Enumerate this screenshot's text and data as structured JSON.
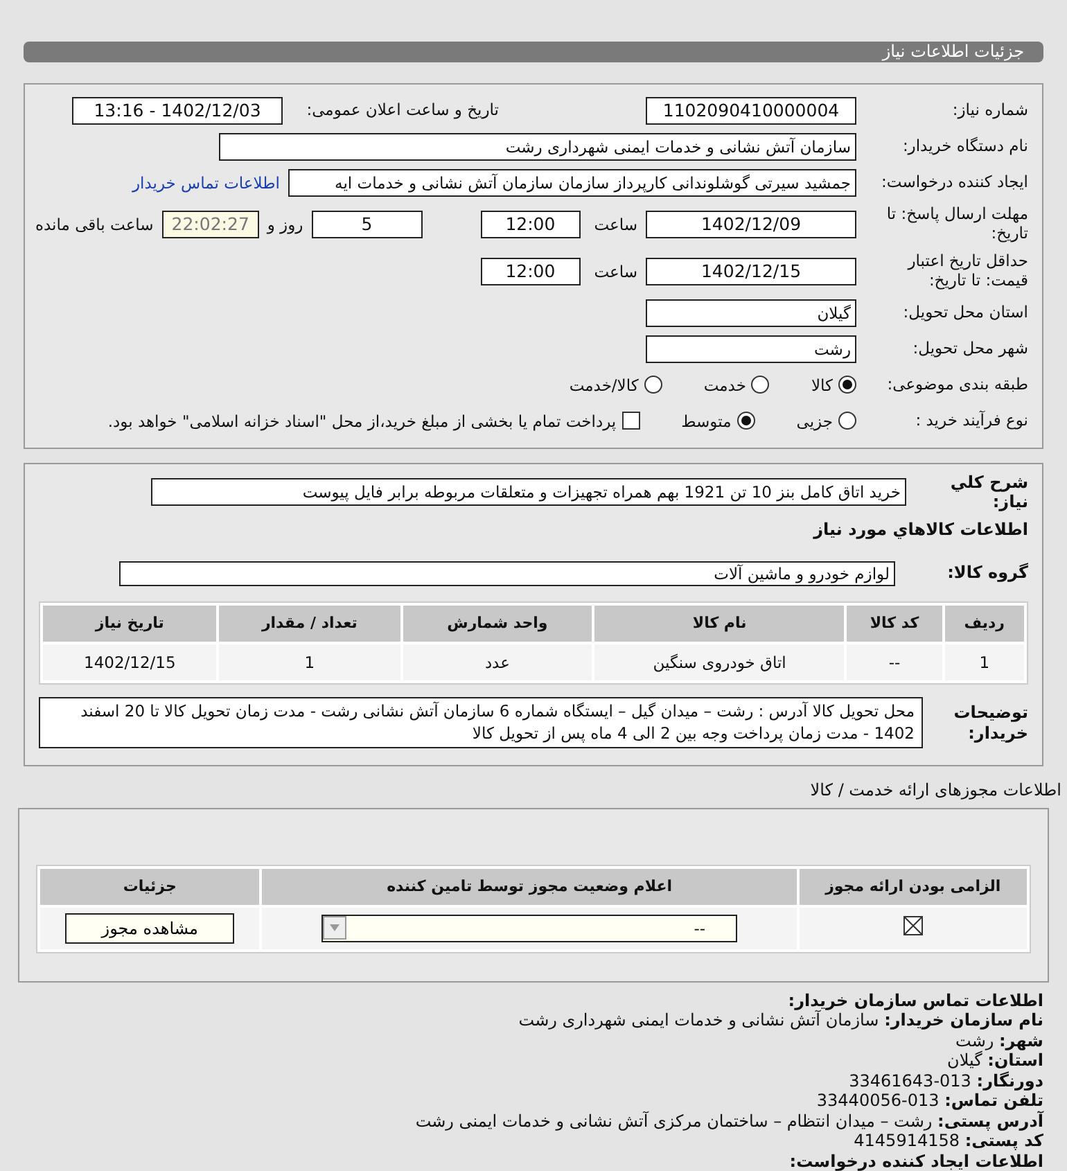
{
  "page_title": "جزئیات اطلاعات نیاز",
  "need": {
    "number_label": "شماره نیاز:",
    "number": "1102090410000004",
    "announce_label": "تاریخ و ساعت اعلان عمومی:",
    "announce": "1402/12/03 - 13:16",
    "buyer_label": "نام دستگاه خریدار:",
    "buyer": "سازمان آتش نشانی و خدمات ایمنی شهرداری رشت",
    "creator_label": "ایجاد کننده درخواست:",
    "creator": "جمشید سیرتی گوشلوندانی کارپرداز سازمان سازمان آتش نشانی و خدمات ایه",
    "contact_link": "اطلاعات تماس خریدار",
    "deadline_label": "مهلت ارسال پاسخ: تا تاریخ:",
    "deadline_date": "1402/12/09",
    "time_label": "ساعت",
    "deadline_time": "12:00",
    "days": "5",
    "days_label": "روز و",
    "remaining": "22:02:27",
    "remaining_label": "ساعت باقی مانده",
    "validity_label": "حداقل تاریخ اعتبار قیمت: تا تاریخ:",
    "validity_date": "1402/12/15",
    "validity_time_label": "ساعت",
    "validity_time": "12:00",
    "province_label": "استان محل تحویل:",
    "province": "گیلان",
    "city_label": "شهر محل تحویل:",
    "city": "رشت",
    "category_label": "طبقه بندی موضوعی:",
    "categories": [
      {
        "label": "کالا",
        "selected": true
      },
      {
        "label": "خدمت",
        "selected": false
      },
      {
        "label": "کالا/خدمت",
        "selected": false
      }
    ],
    "process_label": "نوع فرآیند خرید :",
    "processes": [
      {
        "label": "جزیی",
        "selected": false
      },
      {
        "label": "متوسط",
        "selected": true
      }
    ],
    "payment": {
      "label": "پرداخت تمام یا بخشی از مبلغ خرید،از محل \"اسناد خزانه اسلامی\" خواهد بود.",
      "checked": false
    }
  },
  "goods": {
    "summary_label": "شرح کلي نياز:",
    "summary": "خرید اتاق کامل بنز 10 تن 1921 بهم همراه تجهیزات و متعلقات مربوطه برابر فایل پیوست",
    "heading": "اطلاعات كالاهاي مورد نياز",
    "group_label": "گروه کالا:",
    "group": "لوازم خودرو و ماشین آلات",
    "table": {
      "columns": [
        "ردیف",
        "کد کالا",
        "نام کالا",
        "واحد شمارش",
        "تعداد / مقدار",
        "تاریخ نیاز"
      ],
      "rows": [
        [
          "1",
          "--",
          "اتاق خودروی سنگین",
          "عدد",
          "1",
          "1402/12/15"
        ]
      ]
    },
    "notes_label": "توضیحات خریدار:",
    "notes": "محل تحویل کالا آدرس : رشت – میدان گیل – ایستگاه شماره 6 سازمان آتش نشانی رشت - مدت زمان تحویل کالا تا 20 اسفند 1402 - مدت زمان پرداخت وجه بین 2 الی 4 ماه پس از تحویل کالا"
  },
  "licenses": {
    "heading": "اطلاعات مجوزهای ارائه خدمت / کالا",
    "columns": [
      "الزامی بودن ارائه مجوز",
      "اعلام وضعیت مجوز توسط تامین کننده",
      "جزئیات"
    ],
    "rows": [
      {
        "required": true,
        "status": "--",
        "button": "مشاهده مجوز"
      }
    ]
  },
  "contact": {
    "heading": "اطلاعات تماس سازمان خریدار:",
    "lines": [
      {
        "label": "نام سازمان خریدار:",
        "value": "سازمان آتش نشانی و خدمات ایمنی شهرداری رشت"
      },
      {
        "label": "شهر:",
        "value": "رشت"
      },
      {
        "label": "استان:",
        "value": "گیلان"
      },
      {
        "label": "دورنگار:",
        "value": "013-33461643"
      },
      {
        "label": "تلفن تماس:",
        "value": "013-33440056"
      },
      {
        "label": "آدرس پستی:",
        "value": "رشت – میدان انتظام – ساختمان مرکزی آتش نشانی و خدمات ایمنی رشت"
      },
      {
        "label": "کد پستی:",
        "value": "4145914158"
      }
    ],
    "next_heading": "اطلاعات ایجاد کننده درخواست:"
  }
}
